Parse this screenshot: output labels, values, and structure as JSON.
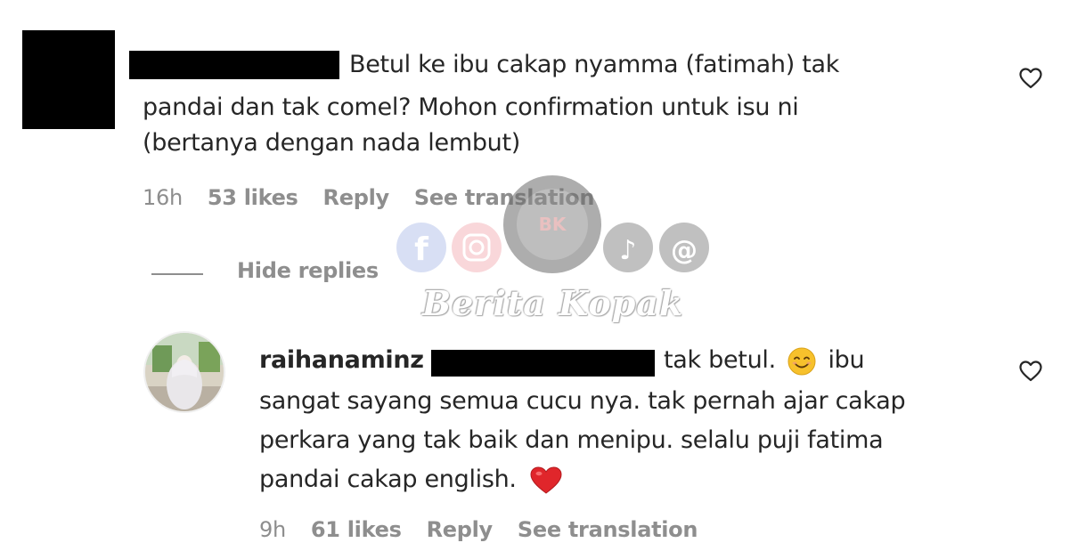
{
  "comment": {
    "text_line1": "Betul ke ibu cakap nyamma (fatimah) tak",
    "text_line2": "pandai dan tak comel? Mohon confirmation untuk isu ni",
    "text_line3": "(bertanya dengan nada lembut)",
    "time": "16h",
    "likes": "53 likes",
    "reply_label": "Reply",
    "translation_label": "See translation"
  },
  "thread": {
    "hide_replies_label": "Hide replies"
  },
  "reply": {
    "username": "raihanaminz",
    "text_line1_a": "tak betul.",
    "text_line1_b": "ibu",
    "text_line2": "sangat sayang semua cucu nya. tak pernah ajar cakap",
    "text_line3": "perkara yang tak baik dan menipu. selalu puji fatima",
    "text_line4": "pandai cakap english.",
    "time": "9h",
    "likes": "61 likes",
    "reply_label": "Reply",
    "translation_label": "See translation"
  },
  "watermark": {
    "text": "Berita Kopak",
    "badge": "BK",
    "icons": [
      "facebook-icon",
      "instagram-icon",
      "tiktok-icon",
      "threads-icon"
    ]
  },
  "colors": {
    "text": "#262626",
    "secondary": "#8e8e8e",
    "heart_emoji": "#e0262b",
    "smile_emoji": "#f7c12c"
  }
}
